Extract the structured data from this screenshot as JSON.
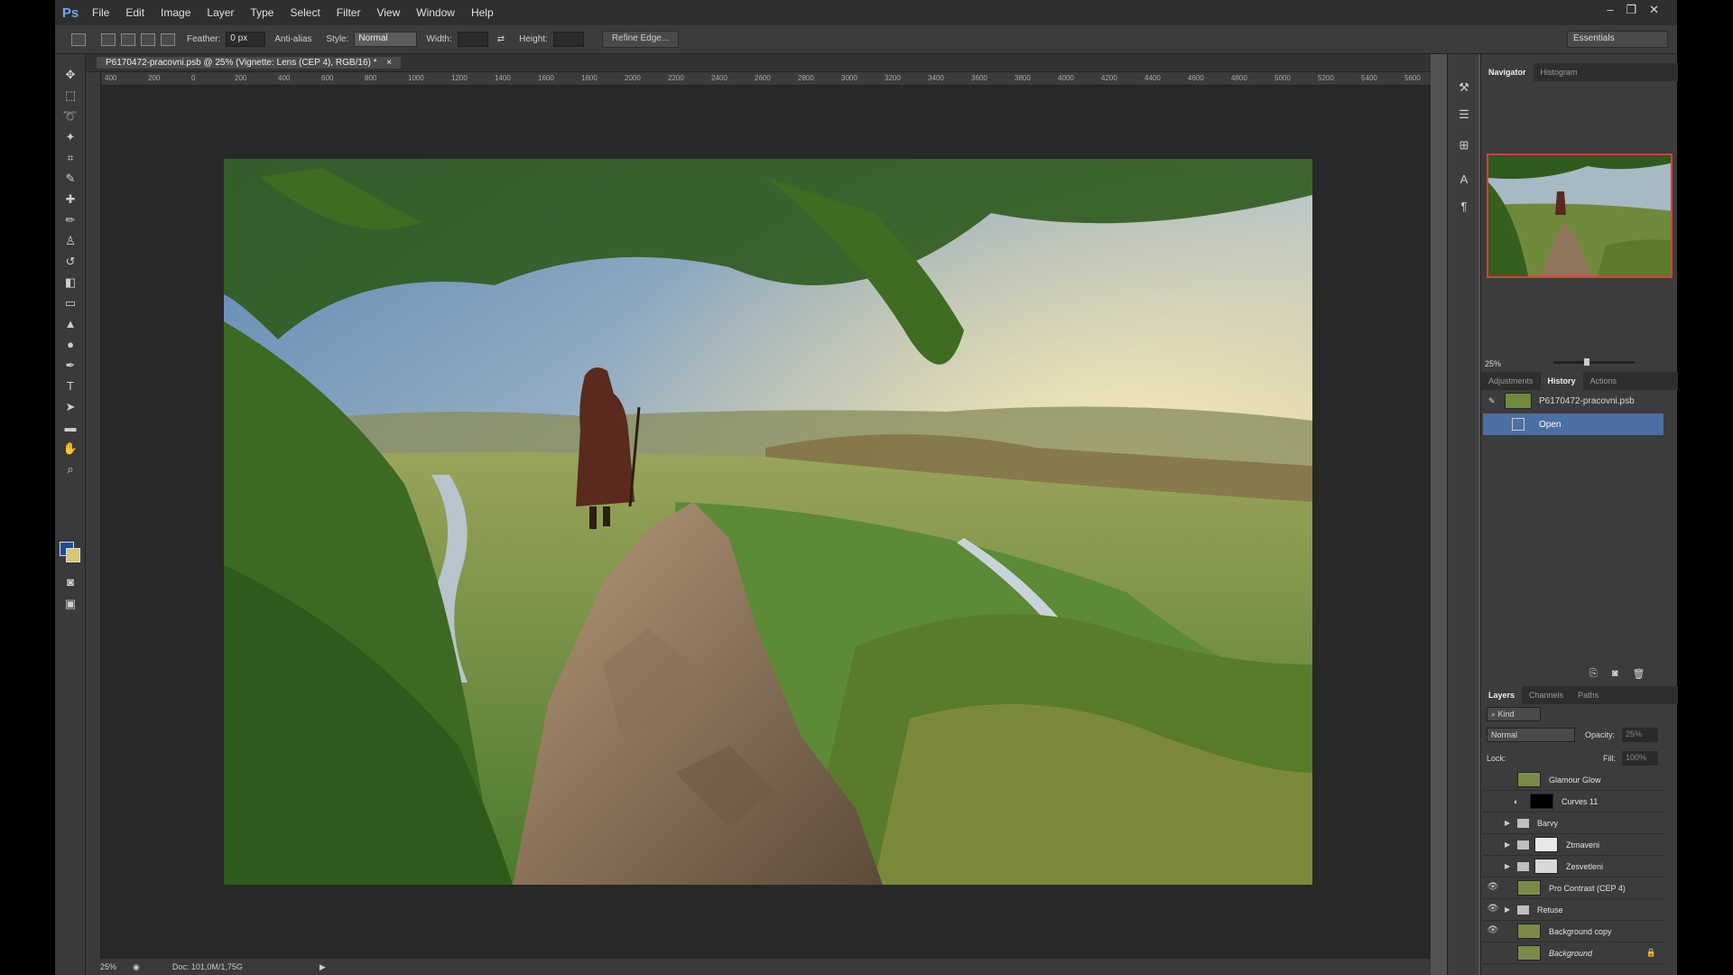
{
  "app": {
    "logo": "Ps",
    "menu": [
      "File",
      "Edit",
      "Image",
      "Layer",
      "Type",
      "Select",
      "Filter",
      "View",
      "Window",
      "Help"
    ],
    "window_controls": [
      "–",
      "❐",
      "✕"
    ]
  },
  "options": {
    "feather_label": "Feather:",
    "feather_value": "0 px",
    "antialias_label": "Anti-alias",
    "style_label": "Style:",
    "style_value": "Normal",
    "width_label": "Width:",
    "height_label": "Height:",
    "refine_label": "Refine Edge...",
    "workspace": "Essentials"
  },
  "document": {
    "tab_title": "P6170472-pracovni.psb @ 25% (Vignette: Lens (CEP 4), RGB/16) *",
    "close": "×",
    "ruler_h": [
      "400",
      "200",
      "0",
      "200",
      "400",
      "600",
      "800",
      "1000",
      "1200",
      "1400",
      "1600",
      "1800",
      "2000",
      "2200",
      "2400",
      "2600",
      "2800",
      "3000",
      "3200",
      "3400",
      "3600",
      "3800",
      "4000",
      "4200",
      "4400",
      "4600",
      "4800",
      "5000",
      "5200",
      "5400",
      "5600"
    ]
  },
  "status": {
    "zoom": "25%",
    "doc": "Doc: 101,0M/1,75G"
  },
  "navigator": {
    "tabs": [
      "Navigator",
      "Histogram"
    ],
    "zoom": "25%"
  },
  "history": {
    "tabs": [
      "Adjustments",
      "History",
      "Actions"
    ],
    "items": [
      {
        "label": "P6170472-pracovni.psb",
        "selected": false
      },
      {
        "label": "Open",
        "selected": true
      }
    ]
  },
  "layers": {
    "tabs": [
      "Layers",
      "Channels",
      "Paths"
    ],
    "filter_label": "Kind",
    "blend_mode": "Normal",
    "opacity_label": "Opacity:",
    "opacity_value": "25%",
    "lock_label": "Lock:",
    "fill_label": "Fill:",
    "fill_value": "100%",
    "items": [
      {
        "name": "Glamour Glow",
        "visible": false,
        "type": "image"
      },
      {
        "name": "Curves 11",
        "visible": false,
        "type": "adjustment"
      },
      {
        "name": "Barvy",
        "visible": false,
        "type": "group"
      },
      {
        "name": "Ztmaveni",
        "visible": false,
        "type": "group-mask"
      },
      {
        "name": "Zesvetleni",
        "visible": false,
        "type": "group-mask"
      },
      {
        "name": "Pro Contrast (CEP 4)",
        "visible": true,
        "type": "image"
      },
      {
        "name": "Retuse",
        "visible": true,
        "type": "group"
      },
      {
        "name": "Background copy",
        "visible": true,
        "type": "image"
      },
      {
        "name": "Background",
        "visible": false,
        "type": "image-locked"
      }
    ]
  }
}
